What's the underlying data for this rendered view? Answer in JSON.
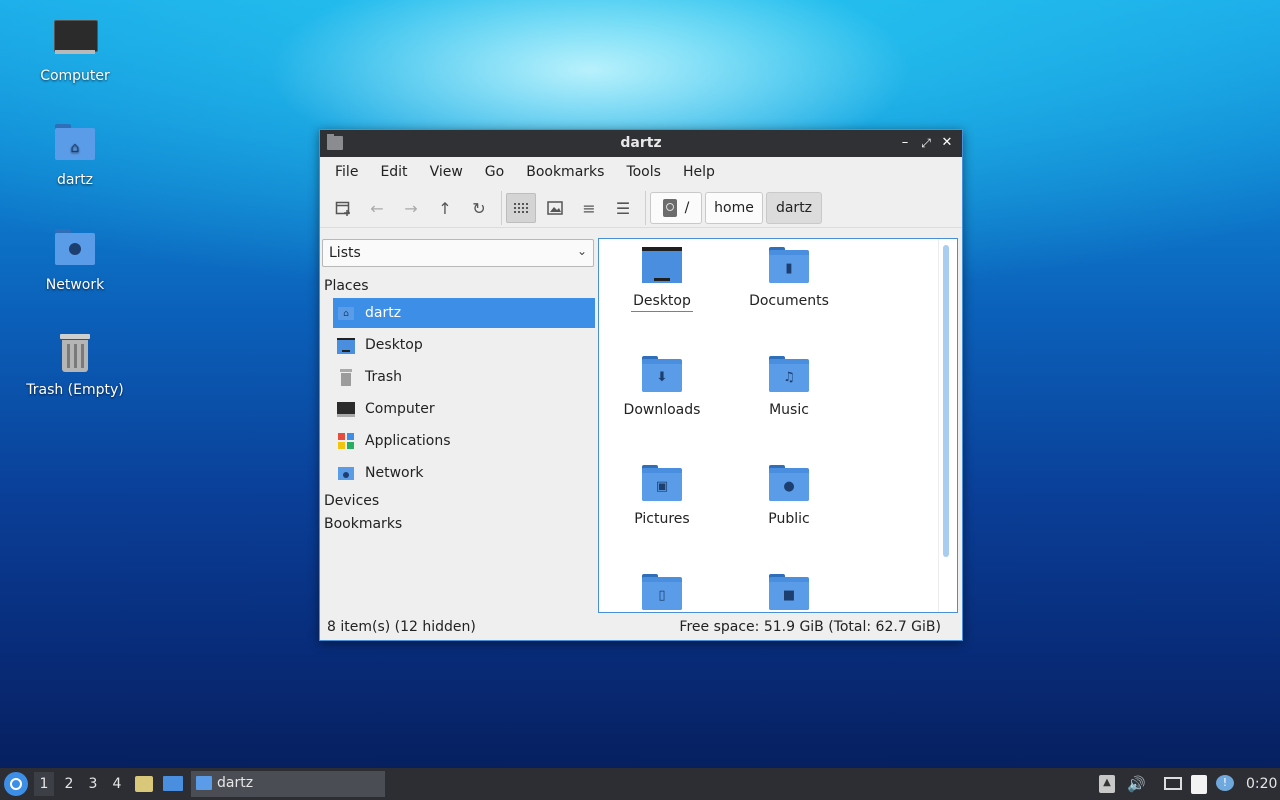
{
  "desktop": {
    "icons": [
      {
        "label": "Computer",
        "icon": "computer-icon"
      },
      {
        "label": "dartz",
        "icon": "home-folder-icon"
      },
      {
        "label": "Network",
        "icon": "network-folder-icon"
      },
      {
        "label": "Trash (Empty)",
        "icon": "trash-icon"
      }
    ]
  },
  "window": {
    "title": "dartz",
    "controls": {
      "minimize": "–",
      "maximize": "⤢",
      "close": "✕"
    },
    "menu": [
      "File",
      "Edit",
      "View",
      "Go",
      "Bookmarks",
      "Tools",
      "Help"
    ],
    "toolbar": {
      "new_tab_icon": "new-tab-icon",
      "back_icon": "←",
      "forward_icon": "→",
      "up_icon": "↑",
      "reload_icon": "↻",
      "view_icons": "icon-view-icon",
      "view_thumbnails": "thumbnail-view-icon",
      "view_compact": "≡",
      "view_detailed": "☰"
    },
    "path": {
      "root": "/",
      "segments": [
        "home",
        "dartz"
      ]
    },
    "side_pane": {
      "mode": "Lists",
      "places_header": "Places",
      "places": [
        {
          "label": "dartz",
          "icon": "home-folder-icon",
          "selected": true
        },
        {
          "label": "Desktop",
          "icon": "desktop-icon"
        },
        {
          "label": "Trash",
          "icon": "trash-icon"
        },
        {
          "label": "Computer",
          "icon": "computer-icon"
        },
        {
          "label": "Applications",
          "icon": "applications-icon"
        },
        {
          "label": "Network",
          "icon": "network-folder-icon"
        }
      ],
      "devices_header": "Devices",
      "bookmarks_header": "Bookmarks"
    },
    "files": [
      {
        "name": "Desktop",
        "emblem": "",
        "focused": true
      },
      {
        "name": "Documents",
        "emblem": "▮"
      },
      {
        "name": "Downloads",
        "emblem": "⬇"
      },
      {
        "name": "Music",
        "emblem": "♫"
      },
      {
        "name": "Pictures",
        "emblem": "▣"
      },
      {
        "name": "Public",
        "emblem": "●"
      },
      {
        "name": "",
        "emblem": "▯"
      },
      {
        "name": "",
        "emblem": "■"
      }
    ],
    "status": {
      "left": "8 item(s) (12 hidden)",
      "right": "Free space: 51.9 GiB (Total: 62.7 GiB)"
    }
  },
  "taskbar": {
    "workspaces": [
      "1",
      "2",
      "3",
      "4"
    ],
    "current_workspace": "1",
    "task_label": "dartz",
    "clock": "0:20"
  },
  "colors": {
    "accent": "#3d8ee6",
    "folder": "#4a8ee0",
    "titlebar": "#2f3135",
    "taskbar": "#2c2e33"
  }
}
